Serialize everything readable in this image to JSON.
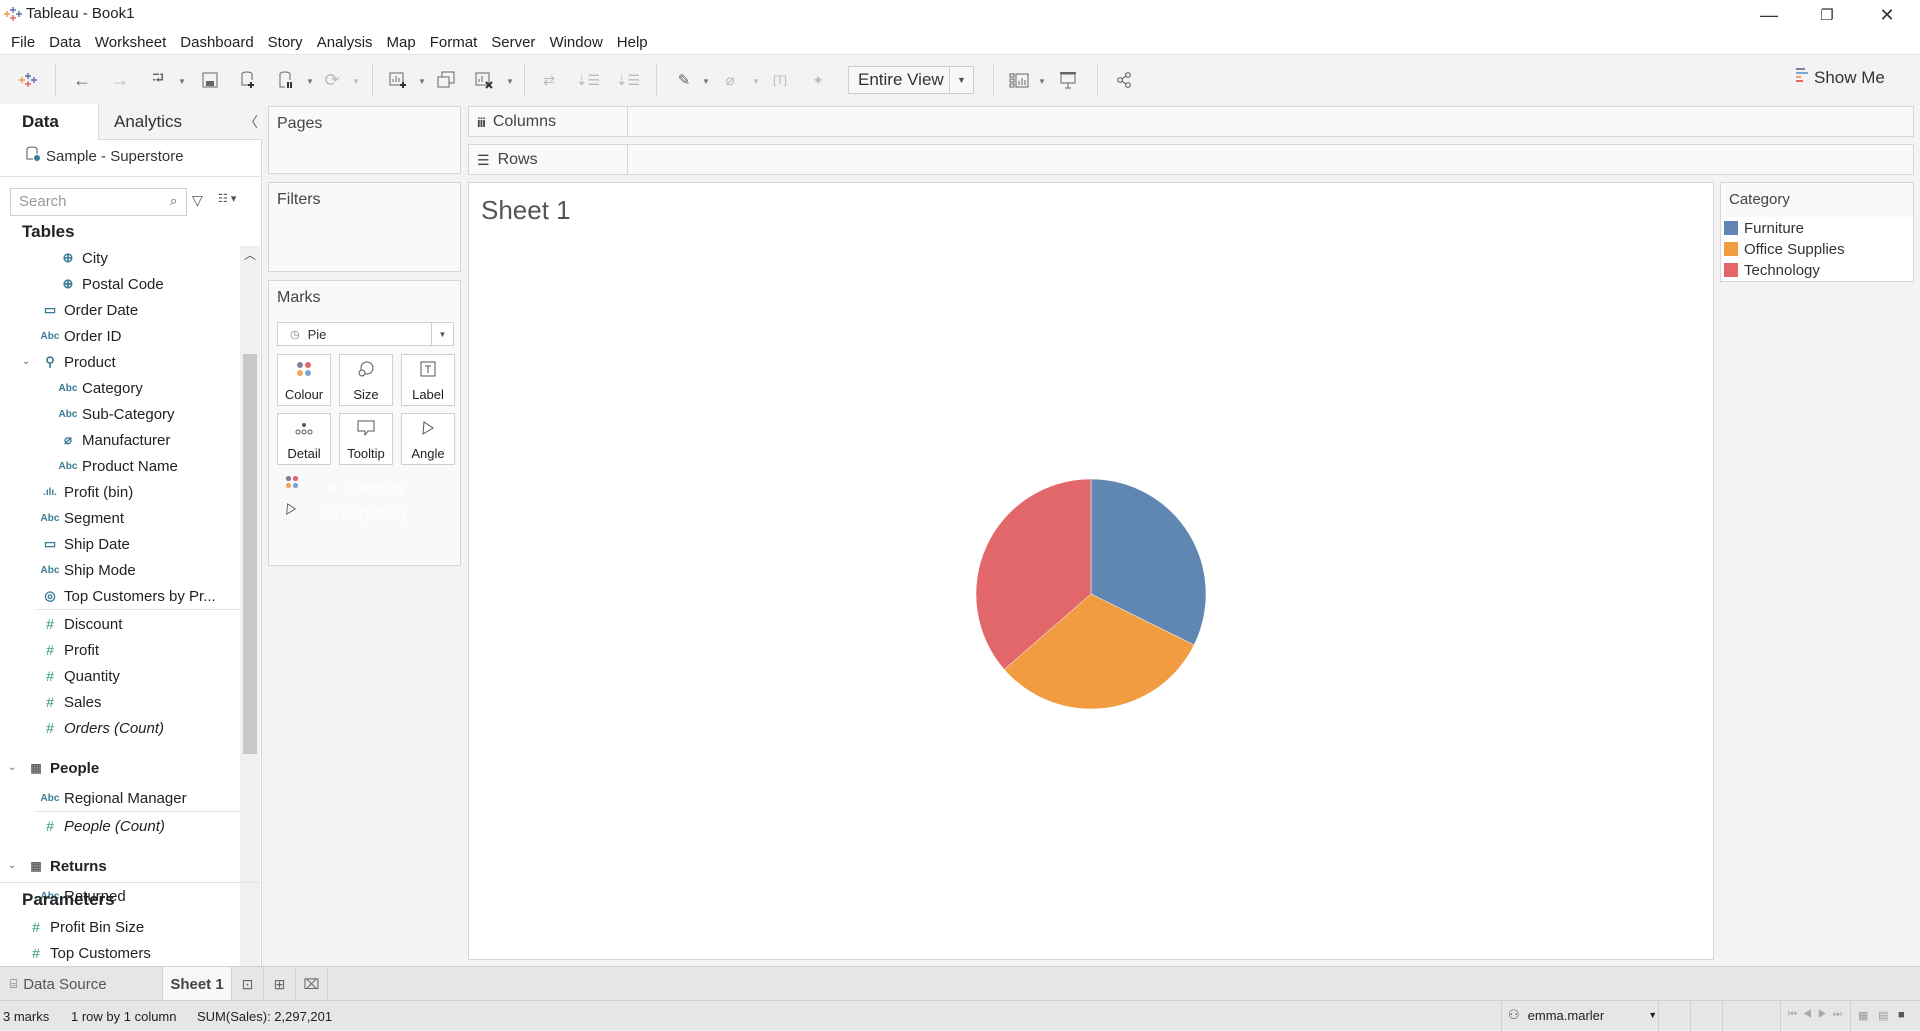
{
  "window": {
    "title": "Tableau - Book1",
    "controls": {
      "minimize": "—",
      "restore": "❐",
      "close": "✕"
    }
  },
  "menu": [
    "File",
    "Data",
    "Worksheet",
    "Dashboard",
    "Story",
    "Analysis",
    "Map",
    "Format",
    "Server",
    "Window",
    "Help"
  ],
  "toolbar": {
    "fit_mode": "Entire View",
    "show_me": "Show Me",
    "icons": [
      "tableau-logo",
      "undo",
      "redo",
      "replay",
      "save",
      "new-data-source",
      "pause-auto-updates",
      "refresh",
      "new-worksheet",
      "duplicate-sheet",
      "clear-sheet",
      "swap-rows-columns",
      "sort-ascending",
      "sort-descending",
      "highlight",
      "group-members",
      "show-mark-labels",
      "fix-axes",
      "fit",
      "show-cards",
      "presentation-mode",
      "share"
    ]
  },
  "data_pane": {
    "tabs": {
      "data": "Data",
      "analytics": "Analytics"
    },
    "data_source": "Sample - Superstore",
    "search_placeholder": "Search",
    "tables_heading": "Tables",
    "fields": [
      {
        "name": "City",
        "type": "geo",
        "indent": 2
      },
      {
        "name": "Postal Code",
        "type": "geo",
        "indent": 2
      },
      {
        "name": "Order Date",
        "type": "date",
        "indent": 1
      },
      {
        "name": "Order ID",
        "type": "string",
        "indent": 1
      },
      {
        "name": "Product",
        "type": "hierarchy",
        "indent": 1,
        "expanded": true
      },
      {
        "name": "Category",
        "type": "string",
        "indent": 2
      },
      {
        "name": "Sub-Category",
        "type": "string",
        "indent": 2
      },
      {
        "name": "Manufacturer",
        "type": "group",
        "indent": 2
      },
      {
        "name": "Product Name",
        "type": "string",
        "indent": 2
      },
      {
        "name": "Profit (bin)",
        "type": "bin",
        "indent": 1
      },
      {
        "name": "Segment",
        "type": "string",
        "indent": 1
      },
      {
        "name": "Ship Date",
        "type": "date",
        "indent": 1
      },
      {
        "name": "Ship Mode",
        "type": "string",
        "indent": 1
      },
      {
        "name": "Top Customers by Pr...",
        "type": "set",
        "indent": 1
      },
      {
        "name": "Discount",
        "type": "measure",
        "indent": 1
      },
      {
        "name": "Profit",
        "type": "measure",
        "indent": 1
      },
      {
        "name": "Quantity",
        "type": "measure",
        "indent": 1
      },
      {
        "name": "Sales",
        "type": "measure",
        "indent": 1
      },
      {
        "name": "Orders (Count)",
        "type": "measure",
        "indent": 1,
        "italic": true
      },
      {
        "name": "People",
        "type": "table",
        "indent": 0,
        "expanded": true
      },
      {
        "name": "Regional Manager",
        "type": "string",
        "indent": 1
      },
      {
        "name": "People (Count)",
        "type": "measure",
        "indent": 1,
        "italic": true
      },
      {
        "name": "Returns",
        "type": "table",
        "indent": 0,
        "expanded": true
      },
      {
        "name": "Returned",
        "type": "string",
        "indent": 1
      }
    ],
    "parameters_heading": "Parameters",
    "parameters": [
      "Profit Bin Size",
      "Top Customers"
    ]
  },
  "cards": {
    "pages": "Pages",
    "filters": "Filters",
    "marks": "Marks",
    "mark_type": "Pie",
    "mark_buttons": [
      "Colour",
      "Size",
      "Label",
      "Detail",
      "Tooltip",
      "Angle"
    ],
    "pills": [
      {
        "role": "colour",
        "label": "Category",
        "color": "#4996b2"
      },
      {
        "role": "angle",
        "label": "SUM(Sales)",
        "color": "#00b180"
      }
    ]
  },
  "shelves": {
    "columns": "Columns",
    "rows": "Rows"
  },
  "sheet": {
    "title": "Sheet 1"
  },
  "legend": {
    "title": "Category",
    "items": [
      {
        "label": "Furniture",
        "color": "#5f87b1"
      },
      {
        "label": "Office Supplies",
        "color": "#f29c42"
      },
      {
        "label": "Technology",
        "color": "#e2676b"
      }
    ]
  },
  "chart_data": {
    "type": "pie",
    "title": "Sheet 1",
    "categories": [
      "Furniture",
      "Office Supplies",
      "Technology"
    ],
    "values": [
      741999.8,
      719047.0,
      836154.0
    ],
    "measure": "SUM(Sales)",
    "colors": [
      "#5f87b1",
      "#f29c42",
      "#e2676b"
    ],
    "legend": "top-right",
    "start_angle": "12 o'clock, clockwise"
  },
  "bottom_tabs": {
    "data_source": "Data Source",
    "sheet": "Sheet 1"
  },
  "status": {
    "marks": "3 marks",
    "dims": "1 row by 1 column",
    "sum": "SUM(Sales): 2,297,201",
    "user": "emma.marler"
  }
}
